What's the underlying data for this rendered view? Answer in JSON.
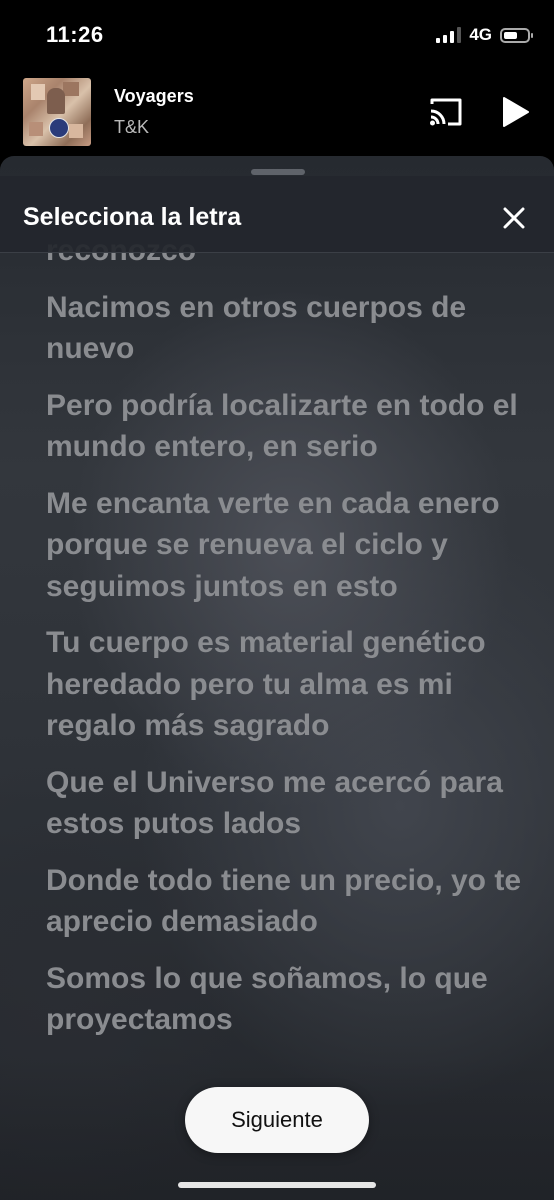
{
  "status_bar": {
    "time": "11:26",
    "network": "4G",
    "battery_level": 0.6,
    "signal_bars": 3
  },
  "now_playing": {
    "title": "Voyagers",
    "artist": "T&K",
    "cast_icon": "cast-icon",
    "play_icon": "play-icon"
  },
  "sheet": {
    "title": "Selecciona la letra",
    "close_icon": "close-icon",
    "lyrics": [
      "reconozco",
      "Nacimos en otros cuerpos de nuevo",
      "Pero podría localizarte en todo el mundo entero, en serio",
      "Me encanta verte en cada enero porque se renueva el ciclo y seguimos juntos en esto",
      "Tu cuerpo es material genético heredado pero tu alma es mi regalo más sagrado",
      "Que el Universo me acercó para estos putos lados",
      "Donde todo tiene un precio, yo te aprecio demasiado",
      "Somos lo que soñamos, lo que proyectamos"
    ],
    "next_label": "Siguiente"
  },
  "colors": {
    "sheet_background": "#2e3238",
    "lyric_text": "#8a8c90",
    "button_background": "#f7f7f7"
  }
}
